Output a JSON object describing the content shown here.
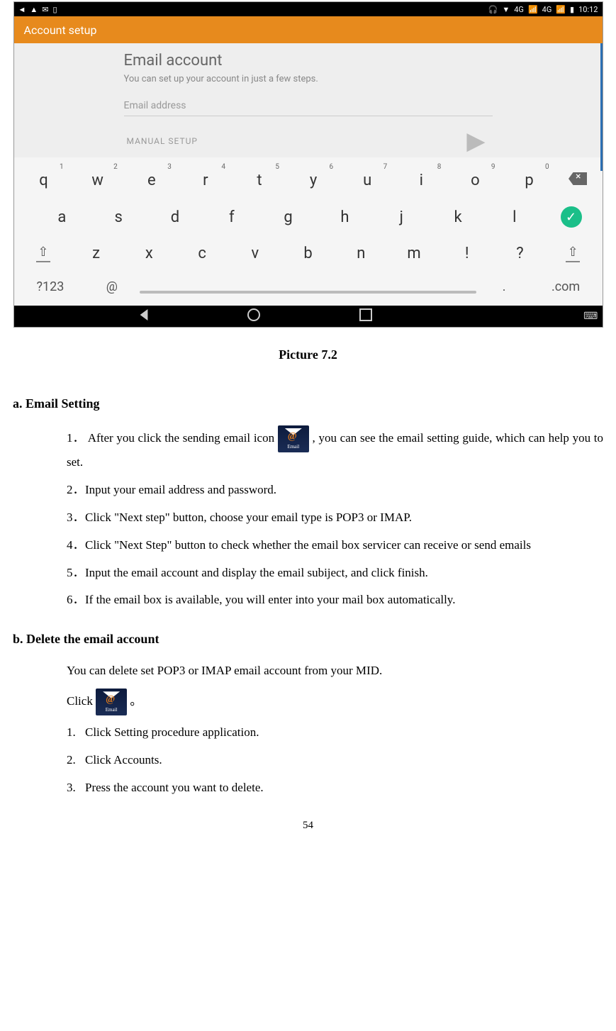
{
  "screenshot": {
    "statusbar": {
      "left_icons": [
        "back-icon",
        "warning-icon",
        "email-icon",
        "sim-icon"
      ],
      "right_text": "4G",
      "right_text2": "4G",
      "battery": "battery-icon",
      "time": "10:12"
    },
    "appbar": {
      "title": "Account setup"
    },
    "form": {
      "title": "Email account",
      "subtitle": "You can set up your account in just a few steps.",
      "field_placeholder": "Email address",
      "manual": "MANUAL SETUP"
    },
    "keyboard": {
      "row1": [
        {
          "k": "q",
          "s": "1"
        },
        {
          "k": "w",
          "s": "2"
        },
        {
          "k": "e",
          "s": "3"
        },
        {
          "k": "r",
          "s": "4"
        },
        {
          "k": "t",
          "s": "5"
        },
        {
          "k": "y",
          "s": "6"
        },
        {
          "k": "u",
          "s": "7"
        },
        {
          "k": "i",
          "s": "8"
        },
        {
          "k": "o",
          "s": "9"
        },
        {
          "k": "p",
          "s": "0"
        }
      ],
      "row2": [
        "a",
        "s",
        "d",
        "f",
        "g",
        "h",
        "j",
        "k",
        "l"
      ],
      "row3": [
        "z",
        "x",
        "c",
        "v",
        "b",
        "n",
        "m",
        "!",
        "?"
      ],
      "sym": "?123",
      "at": "@",
      "dot": ".",
      "com": ".com"
    }
  },
  "caption": "Picture 7.2",
  "sectionA": {
    "title": "a. Email Setting",
    "items": [
      {
        "n": "1．",
        "pre": "After you click the sending email icon  ",
        "post": ", you can see the email setting guide, which can help you to set."
      },
      {
        "n": "2．",
        "text": "Input your email address and password."
      },
      {
        "n": "3．",
        "text": "Click \"Next step\" button, choose your email type is POP3 or IMAP."
      },
      {
        "n": "4．",
        "text": "Click \"Next Step\" button to check whether the email box servicer can receive or send emails"
      },
      {
        "n": "5．",
        "text": "Input the email account and display the email subiject, and click finish."
      },
      {
        "n": "6．",
        "text": "If the email box is available, you will enter into your mail box automatically."
      }
    ]
  },
  "sectionB": {
    "title": "b. Delete the email account",
    "intro": "You can delete set POP3 or IMAP email account from your MID.",
    "click": "Click",
    "suffix": "。",
    "items": [
      {
        "n": "1.",
        "text": "Click Setting procedure application."
      },
      {
        "n": "2.",
        "text": "Click Accounts."
      },
      {
        "n": "3.",
        "text": "Press the account you want to delete."
      }
    ]
  },
  "pagenum": "54",
  "iconlabel": "Email"
}
